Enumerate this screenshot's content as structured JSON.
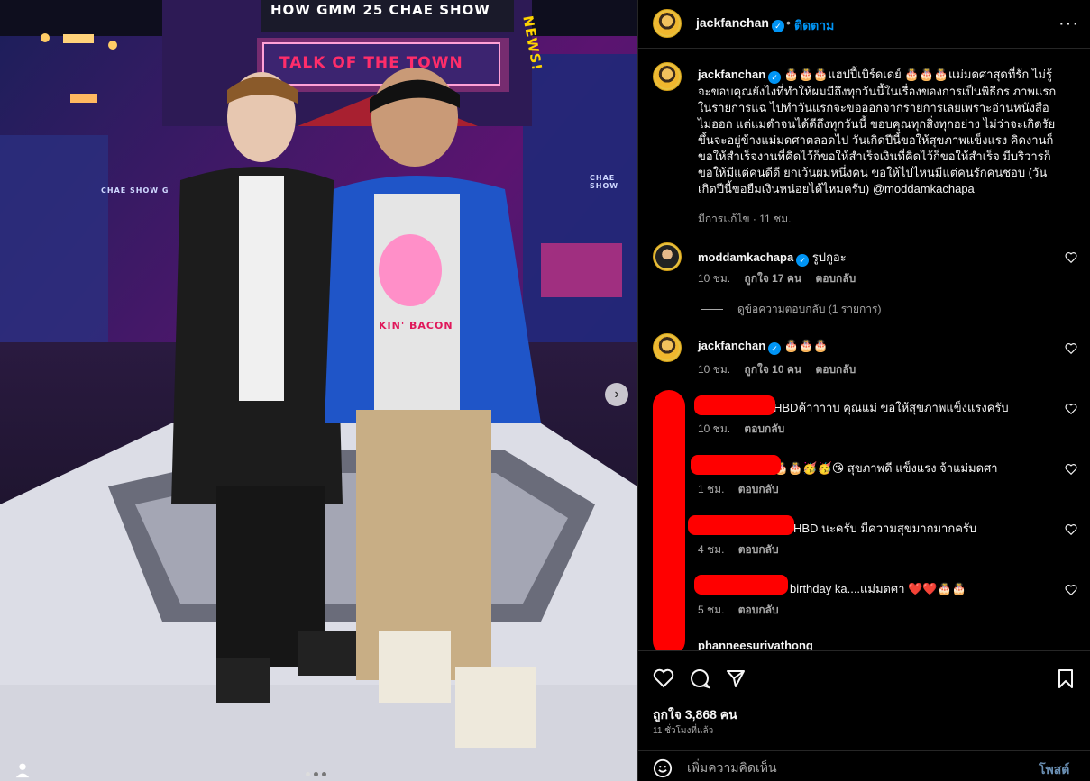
{
  "media": {
    "sign_top": "HOW GMM 25   CHAE SHOW",
    "sign_main": "TALK OF THE TOWN",
    "sign_news": "NEWS!",
    "sign_small_left": "CHAE SHOW G",
    "sign_small_right": "CHAE SHOW",
    "shirt_text": "KIN' BACON",
    "next_icon": "chevron-right-icon",
    "carousel_total": 3,
    "carousel_active": 1
  },
  "header": {
    "username": "jackfanchan",
    "separator": "•",
    "follow_label": "ติดตาม",
    "more_icon": "···"
  },
  "caption": {
    "username": "jackfanchan",
    "text": "🎂🎂🎂แฮปปี้เบิร์ดเดย์ 🎂🎂🎂แม่มดศาสุดที่รัก ไม่รู้จะขอบคุณยังไงที่ทำให้ผมมีถึงทุกวันนี้ในเรื่องของการเป็นพิธีกร ภาพแรกในรายการแฉ ไปทำวันแรกจะขอออกจากรายการเลยเพราะอ่านหนังสือไม่ออก แต่แม่ดำจนได้ดีถึงทุกวันนี้ ขอบคุณทุกสิ่งทุกอย่าง ไม่ว่าจะเกิดรัยขึ้นจะอยู่ข้างแม่มดศาตลอดไป วันเกิดปีนี้ขอให้สุขภาพแข็งแรง คิดงานก็ขอให้สำเร็จงานที่คิดไว้ก็ขอให้สำเร็จเงินที่คิดไว้ก็ขอให้สำเร็จ มีบริวารก็ขอให้มีแต่คนดีดี ยกเว้นผมหนึ่งคน ขอให้ไปไหนมีแต่คนรักคนชอบ (วันเกิดปีนี้ขอยืมเงินหน่อยได้ไหมครับ) @moddamkachapa",
    "meta_edited": "มีการแก้ไข · 11 ชม."
  },
  "comments": [
    {
      "username": "moddamkachapa",
      "verified": true,
      "text": "รูปกูอะ",
      "time": "10 ชม.",
      "likes": "ถูกใจ 17 คน",
      "reply": "ตอบกลับ"
    },
    {
      "username": "jackfanchan",
      "verified": true,
      "text": "🎂🎂🎂",
      "time": "10 ชม.",
      "likes": "ถูกใจ 10 คน",
      "reply": "ตอบกลับ"
    },
    {
      "username": "",
      "text": "HBDค้าาาาบ คุณแม่ ขอให้สุขภาพแข็งแรงครับ",
      "time": "10 ชม.",
      "reply": "ตอบกลับ"
    },
    {
      "username": "",
      "text": "🎂🎂🥳🥳😘 สุขภาพดี แข็งแรง จ้าแม่มดศา",
      "time": "1 ชม.",
      "reply": "ตอบกลับ"
    },
    {
      "username": "",
      "text": "HBD นะครับ มีความสุขมากมากครับ",
      "time": "4 ชม.",
      "reply": "ตอบกลับ"
    },
    {
      "username": "",
      "text": "birthday ka....แม่มดศา ❤️❤️🎂🎂",
      "time": "5 ชม.",
      "reply": "ตอบกลับ"
    },
    {
      "username": "phanneesurivathong",
      "text": ""
    }
  ],
  "view_replies": "ดูข้อความตอบกลับ (1 รายการ)",
  "actions": {
    "likes": "ถูกใจ 3,868 คน",
    "time_ago": "11 ชั่วโมงที่แล้ว",
    "comment_placeholder": "เพิ่มความคิดเห็น",
    "post_label": "โพสต์"
  },
  "colors": {
    "accent": "#0095f6",
    "redaction": "#ff0000",
    "background": "#000000"
  }
}
